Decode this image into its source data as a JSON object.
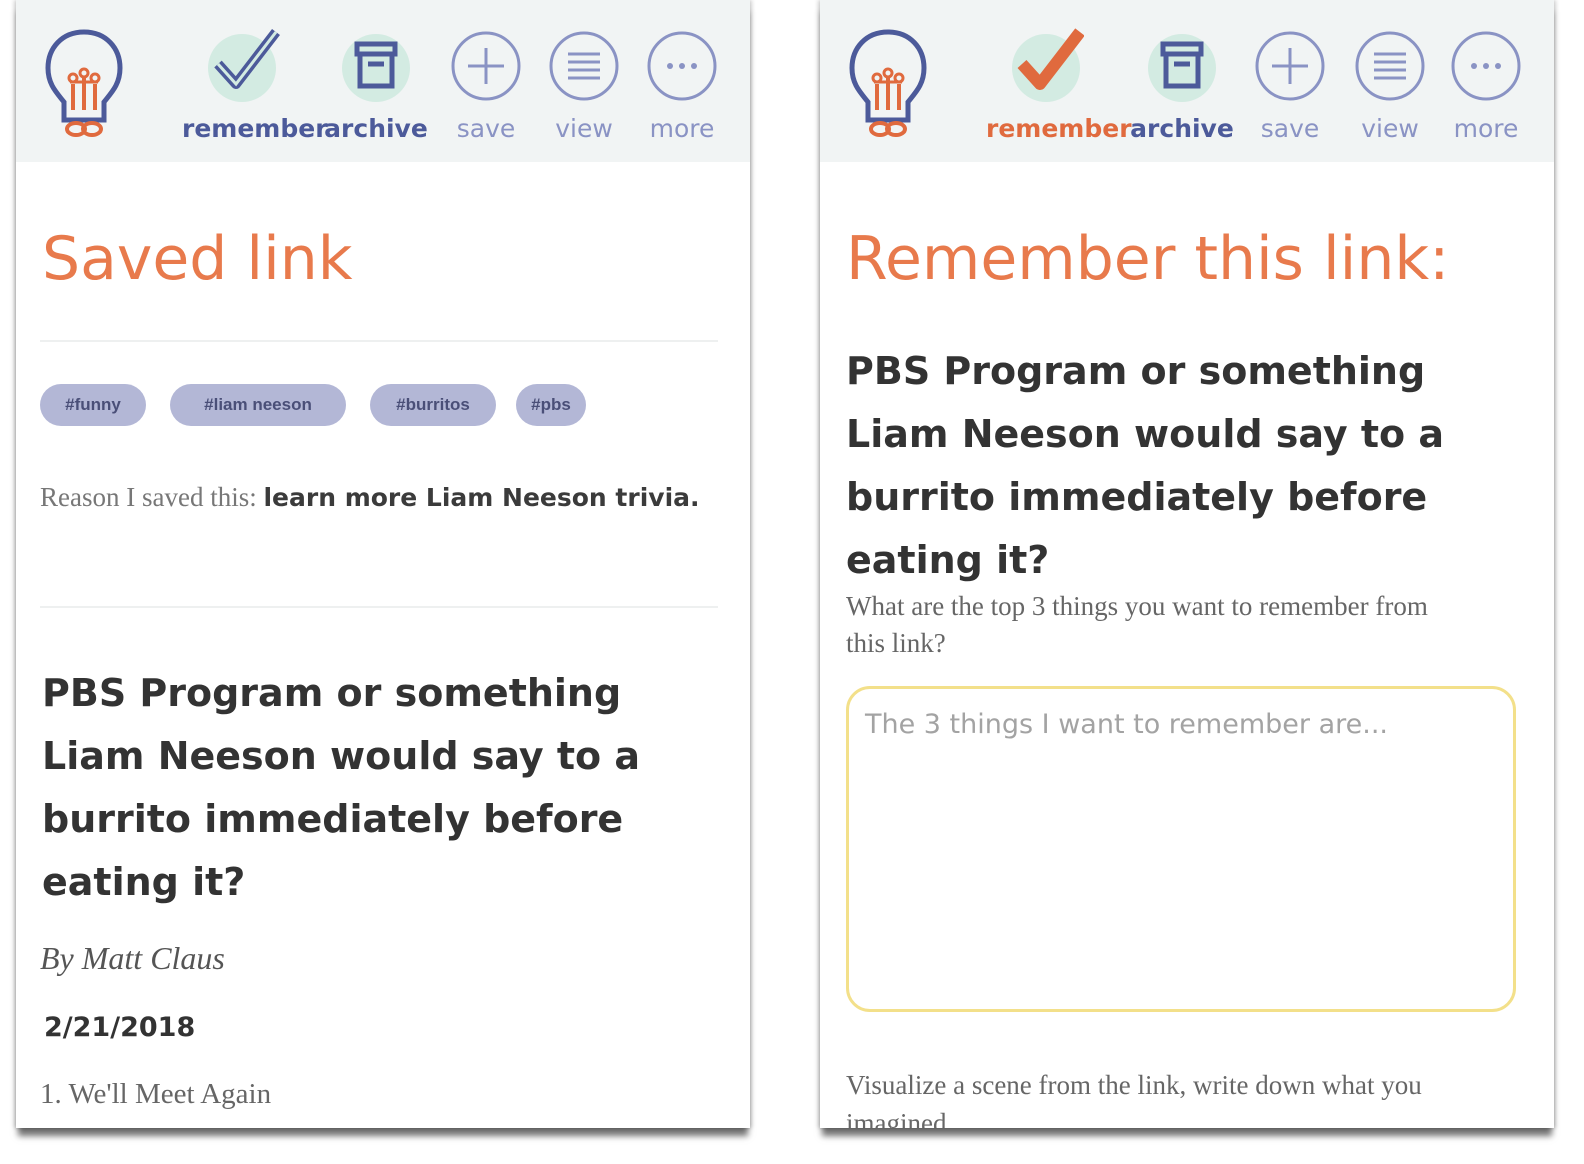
{
  "colors": {
    "accent": "#e06a3e",
    "heading": "#e87a4c",
    "toolbar_bg": "#f1f4f4",
    "icon_blue": "#4c5a9a",
    "icon_light": "#8a93c4",
    "icon_bubble": "#d3ebe2",
    "tag_bg": "#b3b7d6",
    "textarea_border": "#f3e08a"
  },
  "left_screen": {
    "toolbar": {
      "logo_icon": "lightbulb-icon",
      "items": [
        {
          "label": "remember",
          "icon": "checkmark-icon",
          "state": "default"
        },
        {
          "label": "archive",
          "icon": "archive-box-icon",
          "state": "default"
        },
        {
          "label": "save",
          "icon": "plus-circle-icon",
          "state": "default"
        },
        {
          "label": "view",
          "icon": "list-circle-icon",
          "state": "default"
        },
        {
          "label": "more",
          "icon": "more-circle-icon",
          "state": "default"
        }
      ]
    },
    "heading": "Saved link",
    "tags": [
      "#funny",
      "#liam neeson",
      "#burritos",
      "#pbs"
    ],
    "reason_label": "Reason I saved this:",
    "reason_value": "learn more Liam Neeson trivia.",
    "article_title": "PBS Program or something Liam Neeson would say to a burrito immediately before eating it?",
    "byline": "By Matt Claus",
    "date": "2/21/2018",
    "first_item": "1. We'll Meet Again"
  },
  "right_screen": {
    "toolbar": {
      "logo_icon": "lightbulb-icon",
      "items": [
        {
          "label": "remember",
          "icon": "checkmark-icon",
          "state": "active"
        },
        {
          "label": "archive",
          "icon": "archive-box-icon",
          "state": "default"
        },
        {
          "label": "save",
          "icon": "plus-circle-icon",
          "state": "default"
        },
        {
          "label": "view",
          "icon": "list-circle-icon",
          "state": "default"
        },
        {
          "label": "more",
          "icon": "more-circle-icon",
          "state": "default"
        }
      ]
    },
    "heading": "Remember this link:",
    "article_title": "PBS Program or something Liam Neeson would say to a burrito immediately before eating it?",
    "question": "What are the top 3 things you want to remember from this link?",
    "textarea_placeholder": "The 3 things I want to remember are...",
    "visualize_prompt": "Visualize a scene from the link, write down what you imagined"
  }
}
